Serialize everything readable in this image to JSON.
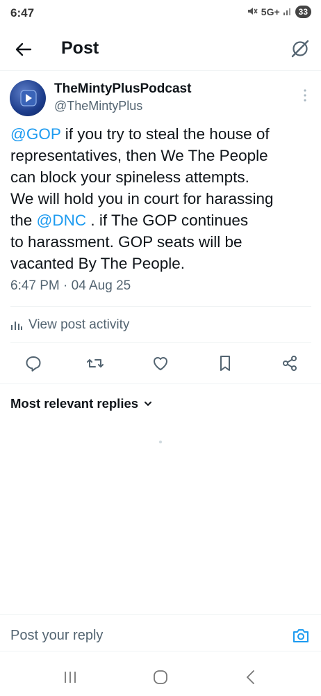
{
  "status_bar": {
    "time": "6:47",
    "network": "5G+",
    "battery": "33"
  },
  "header": {
    "title": "Post",
    "back_icon": "arrow-left-icon",
    "grok_icon": "grok-icon"
  },
  "post": {
    "author_name": "TheMintyPlusPodcast",
    "author_handle": "@TheMintyPlus",
    "text_lines": [
      {
        "mention": "@GOP",
        "text": "  if you try to steal the house of"
      },
      {
        "text": "representatives, then We The People"
      },
      {
        "text": "can block your spineless attempts."
      },
      {
        "text": "We will hold you in court for harassing"
      },
      {
        "pre": "the ",
        "mention": "@DNC",
        "text": " . if The GOP continues"
      },
      {
        "text": "to harassment. GOP seats will be"
      },
      {
        "text": "vacanted By The People."
      }
    ],
    "timestamp": "6:47 PM · 04 Aug 25",
    "activity_label": "View post activity",
    "actions": [
      "reply-icon",
      "repost-icon",
      "like-icon",
      "bookmark-icon",
      "share-icon"
    ]
  },
  "replies": {
    "sort_label": "Most relevant replies"
  },
  "composer": {
    "placeholder": "Post your reply"
  },
  "colors": {
    "accent": "#1d9bf0",
    "text": "#0f1419",
    "secondary": "#536471",
    "divider": "#eff3f4"
  }
}
